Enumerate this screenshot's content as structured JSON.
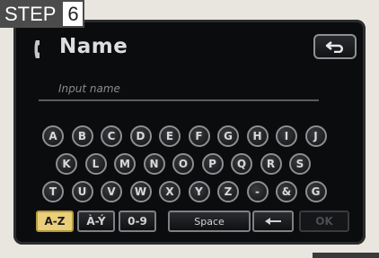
{
  "step": {
    "label": "STEP",
    "number": "6"
  },
  "screen": {
    "title": "Name",
    "input_placeholder": "Input name",
    "rows": [
      [
        "A",
        "B",
        "C",
        "D",
        "E",
        "F",
        "G",
        "H",
        "I",
        "J"
      ],
      [
        "K",
        "L",
        "M",
        "N",
        "O",
        "P",
        "Q",
        "R",
        "S"
      ],
      [
        "T",
        "U",
        "V",
        "W",
        "X",
        "Y",
        "Z",
        "-",
        "&",
        "G"
      ]
    ],
    "modes": {
      "az": "A-Z",
      "ay": "À-Ý",
      "digits": "0-9",
      "space": "Space",
      "ok": "OK"
    }
  },
  "colors": {
    "screen_bg": "#0b0c0d",
    "active_mode": "#e9cf7a",
    "key_border": "#8e8f93"
  },
  "icons": {
    "title": "phone-handset-icon",
    "back": "return-arrow-icon",
    "delete": "backspace-arrow-icon"
  }
}
